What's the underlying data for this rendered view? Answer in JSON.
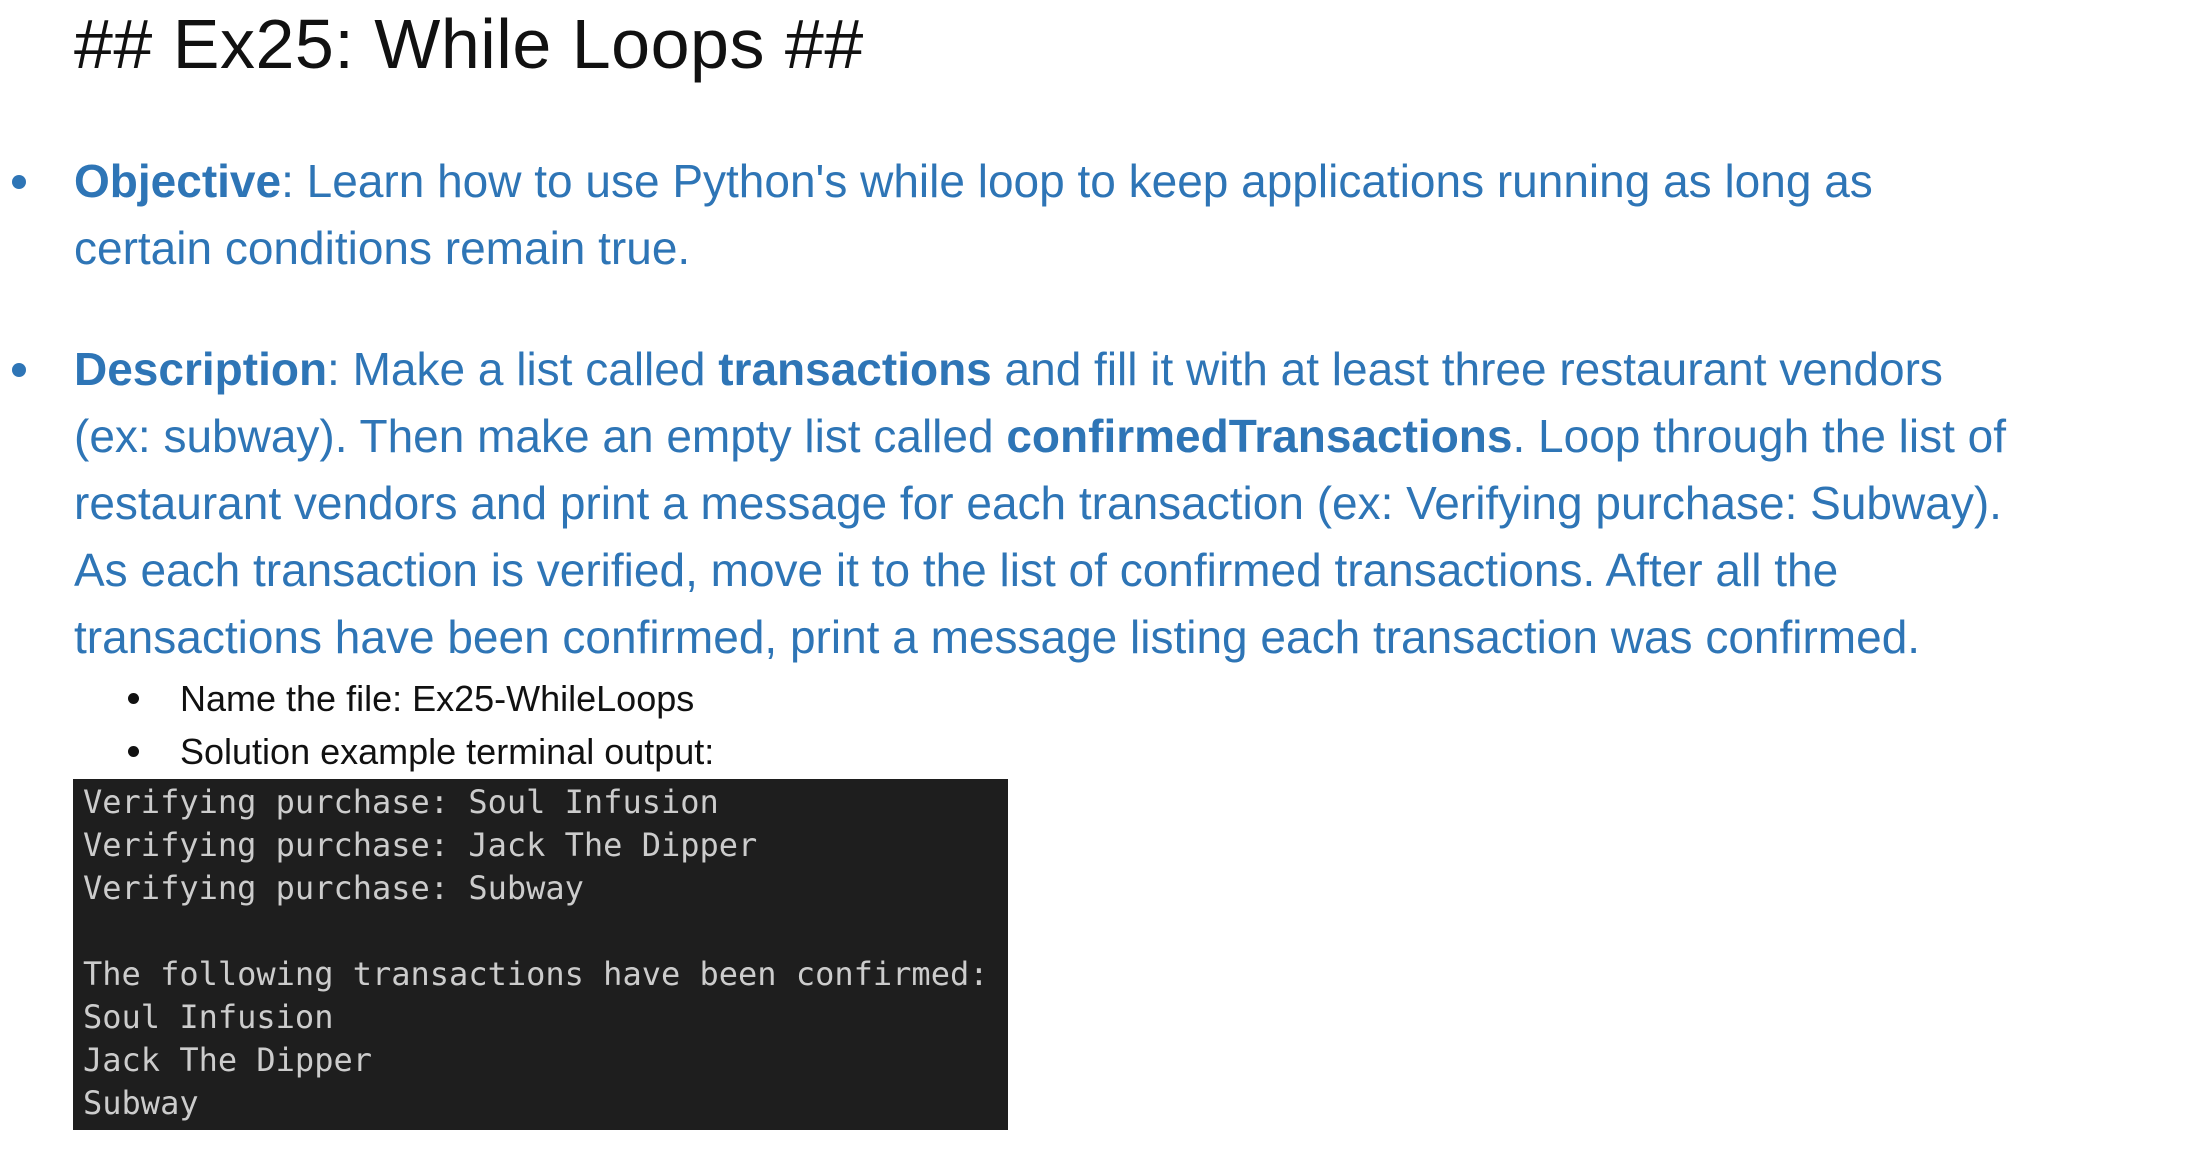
{
  "title": "## Ex25: While Loops ##",
  "objective": {
    "label": "Objective",
    "line1": ": Learn how to use Python's while loop to keep applications running as long as",
    "line2": "certain conditions remain true."
  },
  "description": {
    "label": "Description",
    "line1_rest_a": ": Make a list called ",
    "line1_bold": "transactions",
    "line1_rest_b": " and fill it with at least three restaurant vendors",
    "line2_a": "(ex: subway). Then make an empty list called ",
    "line2_bold": "confirmedTransactions",
    "line2_b": ". Loop through the list of",
    "line3": "restaurant vendors and print a message for each transaction (ex: Verifying purchase: Subway).",
    "line4": "As each transaction is verified, move it to the list of confirmed transactions. After all the",
    "line5": "transactions have been confirmed, print a message listing each transaction was confirmed."
  },
  "sub_bullets": [
    "Name the file: Ex25-WhileLoops",
    "Solution example terminal output:"
  ],
  "terminal": {
    "lines": [
      "Verifying purchase: Soul Infusion",
      "Verifying purchase: Jack The Dipper",
      "Verifying purchase: Subway",
      "",
      "The following transactions have been confirmed:",
      "Soul Infusion",
      "Jack The Dipper",
      "Subway"
    ]
  },
  "colors": {
    "body_text": "#2e75b6",
    "heading": "#111111",
    "terminal_bg": "#1e1e1e",
    "terminal_text": "#cccccc"
  }
}
